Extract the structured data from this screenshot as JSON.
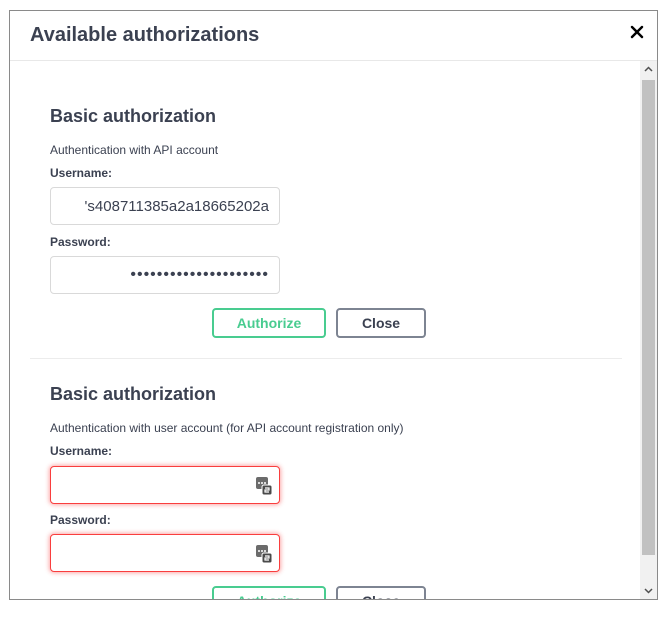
{
  "modal": {
    "title": "Available authorizations",
    "close_glyph": "×"
  },
  "sections": [
    {
      "title": "Basic authorization",
      "description": "Authentication with API account",
      "username_label": "Username:",
      "username_value": "'s408711385a2a18665202a",
      "password_label": "Password:",
      "password_value": "•••••••••••••••••••••",
      "authorize_label": "Authorize",
      "close_label": "Close"
    },
    {
      "title": "Basic authorization",
      "description": "Authentication with user account (for API account registration only)",
      "username_label": "Username:",
      "username_value": "",
      "password_label": "Password:",
      "password_value": "",
      "authorize_label": "Authorize",
      "close_label": "Close",
      "field_icon": "password-manager-icon",
      "field_state": "error"
    }
  ],
  "colors": {
    "authorize": "#49cc90",
    "close_border": "#7d8492",
    "error": "#f93e3e",
    "text": "#3b4151"
  }
}
